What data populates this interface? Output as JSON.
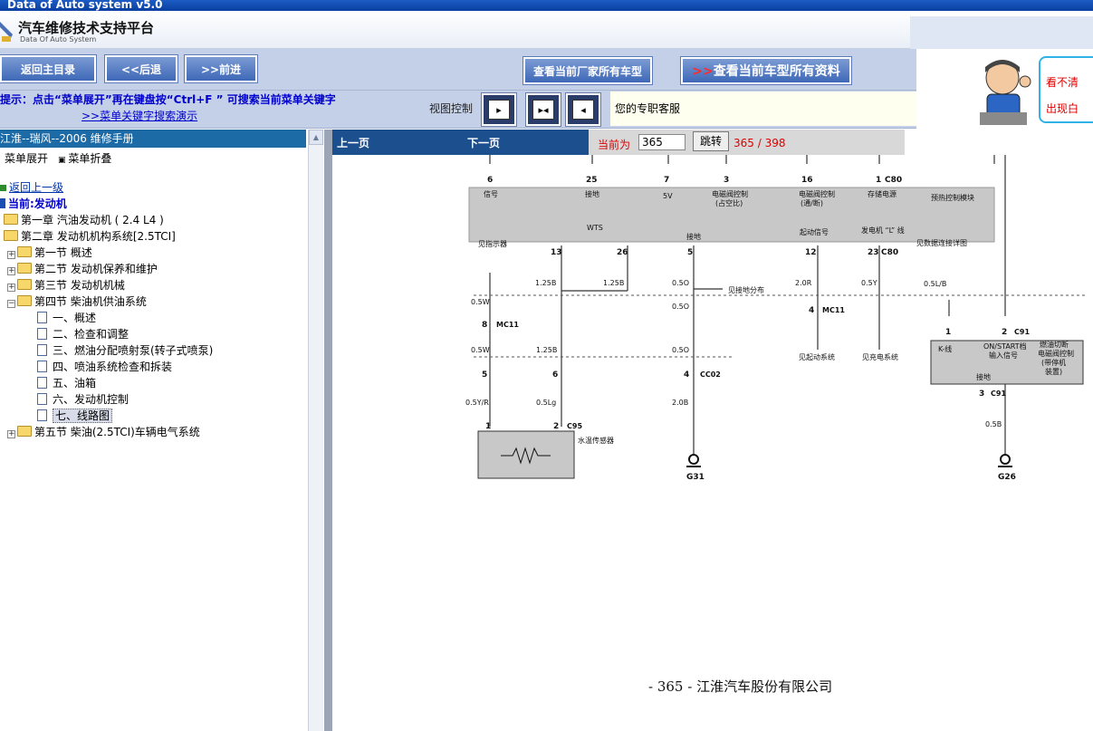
{
  "window": {
    "title": "Data of Auto system v5.0"
  },
  "logo": {
    "title": "汽车维修技术支持平台",
    "subtitle": "Data Of Auto System"
  },
  "nav": {
    "main_menu": "返回主目录",
    "back": "<<后退",
    "forward": ">>前进",
    "all_models": "查看当前厂家所有车型",
    "all_data_arrow": ">>",
    "all_data": "查看当前车型所有资料"
  },
  "side_note": {
    "line1": "看不清",
    "line2": "出现白"
  },
  "hint": {
    "text": "提示：点击“菜单展开”再在键盘按“Ctrl+F ” 可搜索当前菜单关键字",
    "link": ">>菜单关键字搜索演示",
    "view_label": "视图控制",
    "customer_service": "您的专职客服"
  },
  "left": {
    "header": "江淮--瑞风--2006 维修手册",
    "expand": "菜单展开",
    "collapse": "菜单折叠",
    "up_level": "返回上一级",
    "current": "当前:发动机",
    "tree": [
      {
        "label": "第一章  汽油发动机 ( 2.4 L4 )"
      },
      {
        "label": "第二章  发动机机构系统[2.5TCI]"
      },
      {
        "label": "第一节    概述"
      },
      {
        "label": "第二节          发动机保养和维护"
      },
      {
        "label": "第三节    发动机机械"
      },
      {
        "label": "第四节  柴油机供油系统"
      },
      {
        "label": "一、概述"
      },
      {
        "label": "二、检查和调整"
      },
      {
        "label": "三、燃油分配喷射泵(转子式喷泵)"
      },
      {
        "label": "四、喷油系统检查和拆装"
      },
      {
        "label": "五、油箱"
      },
      {
        "label": "六、发动机控制"
      },
      {
        "label": "七、线路图"
      },
      {
        "label": "第五节  柴油(2.5TCI)车辆电气系统"
      }
    ]
  },
  "pager": {
    "prev": "上一页",
    "next": "下一页",
    "current_label": "当前为",
    "page_value": "365",
    "go": "跳转",
    "count": "365 / 398"
  },
  "diagram": {
    "top_pins": [
      "6",
      "25",
      "7",
      "3",
      "16",
      "1"
    ],
    "top_connector": "C80",
    "top_labels": [
      "信号",
      "接地",
      "5V",
      "电磁阀控制",
      "(占空比)",
      "电磁阀控制",
      "(通/断)",
      "存储电源"
    ],
    "module_name": "预热控制模块",
    "mid_labels": [
      "WTS",
      "接地",
      "起动信号",
      "发电机 “L” 线"
    ],
    "bottom_pins": [
      "13",
      "26",
      "5",
      "12",
      "23"
    ],
    "bottom_connector": "C80",
    "wire_labels": [
      "见指示器",
      "1.25B",
      "1.25B",
      "0.5O",
      "2.0R",
      "0.5Y",
      "见数据连接详图",
      "0.5W",
      "0.5O",
      "0.5L/B",
      "0.5W",
      "1.25B",
      "0.5O",
      "0.5Y/R",
      "0.5Lg",
      "2.0B",
      "0.5B"
    ],
    "connectors": [
      "MC11",
      "MC11",
      "CC02",
      "C95",
      "C91",
      "C91"
    ],
    "ground_labels": [
      "G31",
      "G26"
    ],
    "notes": [
      "见接地分布",
      "见起动系统",
      "见充电系统",
      "水温传感器"
    ],
    "relay_box": {
      "left": "K-线",
      "right1": "ON/START档",
      "right2": "输入信号",
      "bottom": "接地"
    },
    "relay_title": [
      "燃油切断",
      "电磁阀控制",
      "(带停机",
      "装置)"
    ],
    "pin_numbers_extra": [
      "8",
      "4",
      "5",
      "6",
      "4",
      "1",
      "2",
      "1",
      "2",
      "3"
    ]
  },
  "page_footer": "- 365 - 江淮汽车股份有限公司"
}
